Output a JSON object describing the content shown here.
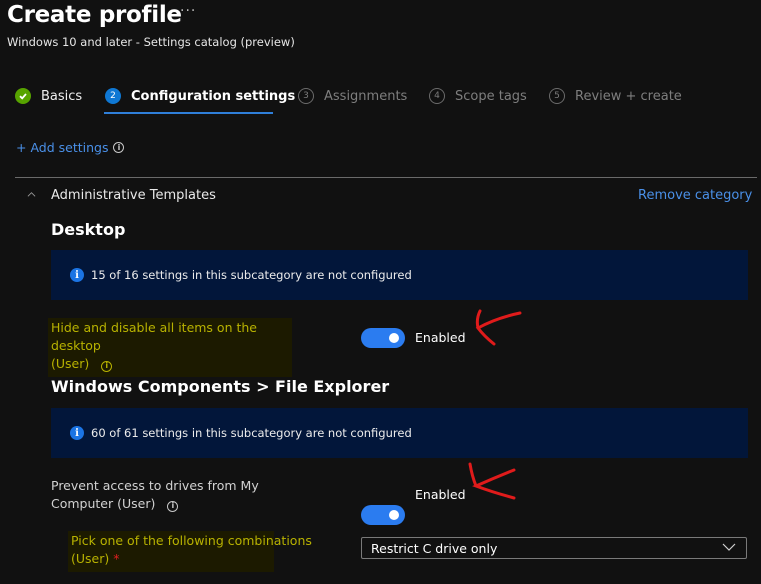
{
  "header": {
    "title": "Create profile",
    "more": "···",
    "subtitle": "Windows 10 and later - Settings catalog (preview)"
  },
  "wizard": {
    "steps": [
      {
        "number": "✓",
        "label": "Basics",
        "state": "done"
      },
      {
        "number": "2",
        "label": "Configuration settings",
        "state": "active"
      },
      {
        "number": "3",
        "label": "Assignments",
        "state": "inactive"
      },
      {
        "number": "4",
        "label": "Scope tags",
        "state": "inactive"
      },
      {
        "number": "5",
        "label": "Review + create",
        "state": "inactive"
      }
    ]
  },
  "add_settings": {
    "label": "+ Add settings",
    "info": "i"
  },
  "category": {
    "title": "Administrative Templates",
    "remove_label": "Remove category",
    "subcategories": [
      {
        "title": "Desktop",
        "banner": "15 of 16 settings in this subcategory are not configured",
        "settings": [
          {
            "label_line1": "Hide and disable all items on the desktop",
            "label_line2": "(User)",
            "value": "Enabled",
            "toggle_on": true
          }
        ]
      },
      {
        "title": "Windows Components > File Explorer",
        "banner": "60 of 61 settings in this subcategory are not configured",
        "settings": [
          {
            "label_line1": "Prevent access to drives from My",
            "label_line2": "Computer (User)",
            "value": "Enabled",
            "toggle_on": true
          }
        ],
        "child_setting": {
          "label_line1": "Pick one of the following combinations",
          "label_line2": "(User)",
          "required_mark": "*",
          "selected": "Restrict C drive only"
        }
      }
    ]
  },
  "colors": {
    "accent": "#2b7cf0",
    "link": "#4a90e8",
    "banner_bg": "#02163a",
    "annotation": "#e01b1b"
  }
}
